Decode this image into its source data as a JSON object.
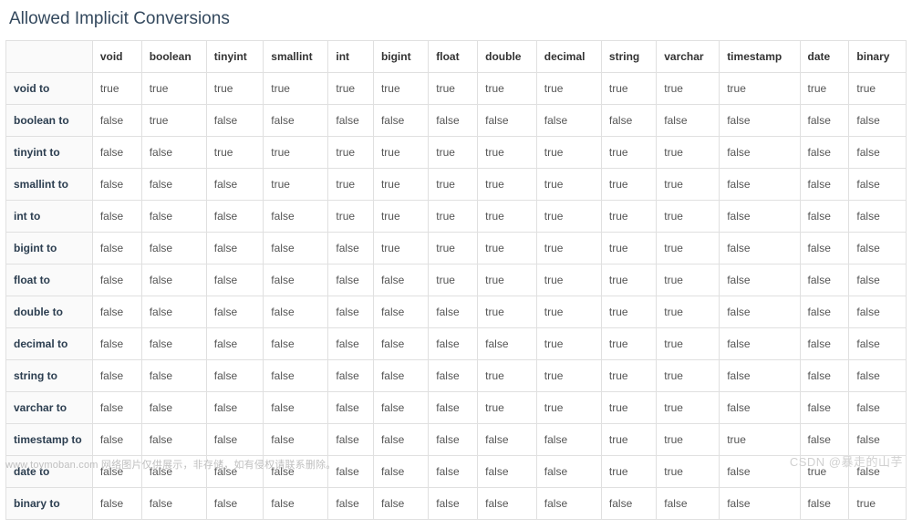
{
  "title": "Allowed Implicit Conversions",
  "columns": [
    "void",
    "boolean",
    "tinyint",
    "smallint",
    "int",
    "bigint",
    "float",
    "double",
    "decimal",
    "string",
    "varchar",
    "timestamp",
    "date",
    "binary"
  ],
  "rows": [
    {
      "label": "void to",
      "cells": [
        "true",
        "true",
        "true",
        "true",
        "true",
        "true",
        "true",
        "true",
        "true",
        "true",
        "true",
        "true",
        "true",
        "true"
      ]
    },
    {
      "label": "boolean to",
      "cells": [
        "false",
        "true",
        "false",
        "false",
        "false",
        "false",
        "false",
        "false",
        "false",
        "false",
        "false",
        "false",
        "false",
        "false"
      ]
    },
    {
      "label": "tinyint to",
      "cells": [
        "false",
        "false",
        "true",
        "true",
        "true",
        "true",
        "true",
        "true",
        "true",
        "true",
        "true",
        "false",
        "false",
        "false"
      ]
    },
    {
      "label": "smallint to",
      "cells": [
        "false",
        "false",
        "false",
        "true",
        "true",
        "true",
        "true",
        "true",
        "true",
        "true",
        "true",
        "false",
        "false",
        "false"
      ]
    },
    {
      "label": "int to",
      "cells": [
        "false",
        "false",
        "false",
        "false",
        "true",
        "true",
        "true",
        "true",
        "true",
        "true",
        "true",
        "false",
        "false",
        "false"
      ]
    },
    {
      "label": "bigint to",
      "cells": [
        "false",
        "false",
        "false",
        "false",
        "false",
        "true",
        "true",
        "true",
        "true",
        "true",
        "true",
        "false",
        "false",
        "false"
      ]
    },
    {
      "label": "float to",
      "cells": [
        "false",
        "false",
        "false",
        "false",
        "false",
        "false",
        "true",
        "true",
        "true",
        "true",
        "true",
        "false",
        "false",
        "false"
      ]
    },
    {
      "label": "double to",
      "cells": [
        "false",
        "false",
        "false",
        "false",
        "false",
        "false",
        "false",
        "true",
        "true",
        "true",
        "true",
        "false",
        "false",
        "false"
      ]
    },
    {
      "label": "decimal to",
      "cells": [
        "false",
        "false",
        "false",
        "false",
        "false",
        "false",
        "false",
        "false",
        "true",
        "true",
        "true",
        "false",
        "false",
        "false"
      ]
    },
    {
      "label": "string to",
      "cells": [
        "false",
        "false",
        "false",
        "false",
        "false",
        "false",
        "false",
        "true",
        "true",
        "true",
        "true",
        "false",
        "false",
        "false"
      ]
    },
    {
      "label": "varchar to",
      "cells": [
        "false",
        "false",
        "false",
        "false",
        "false",
        "false",
        "false",
        "true",
        "true",
        "true",
        "true",
        "false",
        "false",
        "false"
      ]
    },
    {
      "label": "timestamp to",
      "cells": [
        "false",
        "false",
        "false",
        "false",
        "false",
        "false",
        "false",
        "false",
        "false",
        "true",
        "true",
        "true",
        "false",
        "false"
      ]
    },
    {
      "label": "date to",
      "cells": [
        "false",
        "false",
        "false",
        "false",
        "false",
        "false",
        "false",
        "false",
        "false",
        "true",
        "true",
        "false",
        "true",
        "false"
      ]
    },
    {
      "label": "binary to",
      "cells": [
        "false",
        "false",
        "false",
        "false",
        "false",
        "false",
        "false",
        "false",
        "false",
        "false",
        "false",
        "false",
        "false",
        "true"
      ]
    }
  ],
  "watermark_left": "www.toymoban.com 网络图片仅供展示，非存储，如有侵权请联系删除。",
  "watermark_right": "CSDN @暴走的山芋",
  "chart_data": {
    "type": "table",
    "title": "Allowed Implicit Conversions",
    "columns": [
      "void",
      "boolean",
      "tinyint",
      "smallint",
      "int",
      "bigint",
      "float",
      "double",
      "decimal",
      "string",
      "varchar",
      "timestamp",
      "date",
      "binary"
    ],
    "row_labels": [
      "void to",
      "boolean to",
      "tinyint to",
      "smallint to",
      "int to",
      "bigint to",
      "float to",
      "double to",
      "decimal to",
      "string to",
      "varchar to",
      "timestamp to",
      "date to",
      "binary to"
    ],
    "matrix": [
      [
        true,
        true,
        true,
        true,
        true,
        true,
        true,
        true,
        true,
        true,
        true,
        true,
        true,
        true
      ],
      [
        false,
        true,
        false,
        false,
        false,
        false,
        false,
        false,
        false,
        false,
        false,
        false,
        false,
        false
      ],
      [
        false,
        false,
        true,
        true,
        true,
        true,
        true,
        true,
        true,
        true,
        true,
        false,
        false,
        false
      ],
      [
        false,
        false,
        false,
        true,
        true,
        true,
        true,
        true,
        true,
        true,
        true,
        false,
        false,
        false
      ],
      [
        false,
        false,
        false,
        false,
        true,
        true,
        true,
        true,
        true,
        true,
        true,
        false,
        false,
        false
      ],
      [
        false,
        false,
        false,
        false,
        false,
        true,
        true,
        true,
        true,
        true,
        true,
        false,
        false,
        false
      ],
      [
        false,
        false,
        false,
        false,
        false,
        false,
        true,
        true,
        true,
        true,
        true,
        false,
        false,
        false
      ],
      [
        false,
        false,
        false,
        false,
        false,
        false,
        false,
        true,
        true,
        true,
        true,
        false,
        false,
        false
      ],
      [
        false,
        false,
        false,
        false,
        false,
        false,
        false,
        false,
        true,
        true,
        true,
        false,
        false,
        false
      ],
      [
        false,
        false,
        false,
        false,
        false,
        false,
        false,
        true,
        true,
        true,
        true,
        false,
        false,
        false
      ],
      [
        false,
        false,
        false,
        false,
        false,
        false,
        false,
        true,
        true,
        true,
        true,
        false,
        false,
        false
      ],
      [
        false,
        false,
        false,
        false,
        false,
        false,
        false,
        false,
        false,
        true,
        true,
        true,
        false,
        false
      ],
      [
        false,
        false,
        false,
        false,
        false,
        false,
        false,
        false,
        false,
        true,
        true,
        false,
        true,
        false
      ],
      [
        false,
        false,
        false,
        false,
        false,
        false,
        false,
        false,
        false,
        false,
        false,
        false,
        false,
        true
      ]
    ]
  }
}
